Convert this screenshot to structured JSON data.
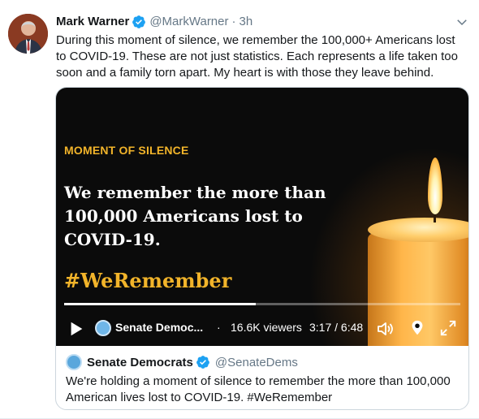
{
  "tweet": {
    "author_name": "Mark Warner",
    "handle": "@MarkWarner",
    "dot": "·",
    "time": "3h",
    "text": "During this moment of silence, we remember the 100,000+ Americans lost to COVID-19. These are not just statistics. Each represents a life taken too soon and a family torn apart. My heart is with those they leave behind."
  },
  "video": {
    "moment_label": "MOMENT OF SILENCE",
    "remember_text": "We remember the more than 100,000 Americans lost to COVID-19.",
    "hashtag": "#WeRemember",
    "progress_fraction": 0.484,
    "source_name": "Senate Democ...",
    "separator": "·",
    "viewers": "16.6K viewers",
    "timecode": "3:17 / 6:48"
  },
  "quoted": {
    "name": "Senate Democrats",
    "handle": "@SenateDems",
    "text": "We're holding a moment of silence to remember the more than 100,000 American lives lost to COVID-19. #WeRemember"
  },
  "colors": {
    "verified": "#1da1f2",
    "accent_gold": "#f2b42a",
    "muted_text": "#657786",
    "border": "#ccd6dd"
  },
  "icons": [
    "verified-icon",
    "chevron-down-icon",
    "play-icon",
    "volume-icon",
    "location-pin-icon",
    "expand-icon"
  ]
}
